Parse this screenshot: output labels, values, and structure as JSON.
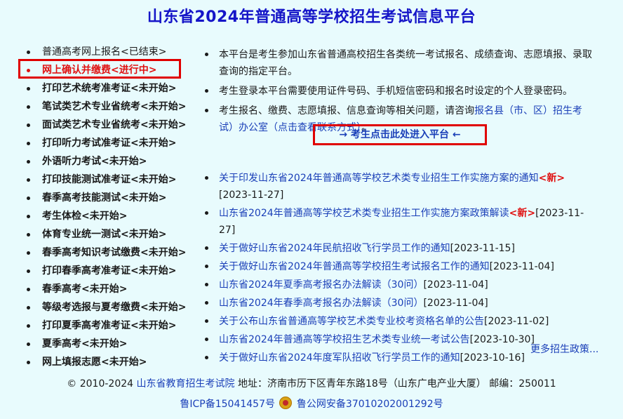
{
  "title": "山东省2024年普通高等学校招生考试信息平台",
  "left_items": [
    {
      "label": "普通高考网上报名<已结束>",
      "state": "normal"
    },
    {
      "label": "网上确认并缴费<进行中>",
      "state": "active"
    },
    {
      "label": "打印艺术统考准考证<未开始>",
      "state": "bold"
    },
    {
      "label": "笔试类艺术专业省统考<未开始>",
      "state": "bold"
    },
    {
      "label": "面试类艺术专业省统考<未开始>",
      "state": "bold"
    },
    {
      "label": "打印听力考试准考证<未开始>",
      "state": "bold"
    },
    {
      "label": "外语听力考试<未开始>",
      "state": "bold"
    },
    {
      "label": "打印技能测试准考证<未开始>",
      "state": "bold"
    },
    {
      "label": "春季高考技能测试<未开始>",
      "state": "bold"
    },
    {
      "label": "考生体检<未开始>",
      "state": "bold"
    },
    {
      "label": "体育专业统一测试<未开始>",
      "state": "bold"
    },
    {
      "label": "春季高考知识考试缴费<未开始>",
      "state": "bold"
    },
    {
      "label": "打印春季高考准考证<未开始>",
      "state": "bold"
    },
    {
      "label": "春季高考<未开始>",
      "state": "bold"
    },
    {
      "label": "等级考选报与夏考缴费<未开始>",
      "state": "bold"
    },
    {
      "label": "打印夏季高考准考证<未开始>",
      "state": "bold"
    },
    {
      "label": "夏季高考<未开始>",
      "state": "bold"
    },
    {
      "label": "网上填报志愿<未开始>",
      "state": "bold"
    }
  ],
  "notes": {
    "n1": "本平台是考生参加山东省普通高校招生各类统一考试报名、成绩查询、志愿填报、录取查询的指定平台。",
    "n2": "考生登录本平台需要使用证件号码、手机短信密码和报名时设定的个人登录密码。",
    "n3_pre": "考生报名、缴费、志愿填报、信息查询等相关问题，请咨询",
    "n3_link": "报名县（市、区）招生考试）办公室（点击查看联系方式）",
    "n3_post": "。"
  },
  "enter_button": "→ 考生点击此处进入平台 ←",
  "news": [
    {
      "title": "关于印发山东省2024年普通高等学校艺术类专业招生工作实施方案的通知",
      "new": "<新>",
      "date": "[2023-11-27]"
    },
    {
      "title": "山东省2024年普通高等学校艺术类专业招生工作实施方案政策解读",
      "new": "<新>",
      "date": "[2023-11-27]"
    },
    {
      "title": "关于做好山东省2024年民航招收飞行学员工作的通知",
      "new": "",
      "date": "[2023-11-15]"
    },
    {
      "title": "关于做好山东省2024年普通高等学校招生考试报名工作的通知",
      "new": "",
      "date": "[2023-11-04]"
    },
    {
      "title": "山东省2024年夏季高考报名办法解读（30问）",
      "new": "",
      "date": "[2023-11-04]"
    },
    {
      "title": "山东省2024年春季高考报名办法解读（30问）",
      "new": "",
      "date": "[2023-11-04]"
    },
    {
      "title": "关于公布山东省普通高等学校艺术类专业校考资格名单的公告",
      "new": "",
      "date": "[2023-11-02]"
    },
    {
      "title": "山东省2024年普通高等学校招生艺术类专业统一考试公告",
      "new": "",
      "date": "[2023-10-30]"
    },
    {
      "title": "关于做好山东省2024年度军队招收飞行学员工作的通知",
      "new": "",
      "date": "[2023-10-16]"
    }
  ],
  "more_link": "更多招生政策...",
  "footer": {
    "copyright": "© 2010-2024",
    "org": "山东省教育招生考试院",
    "address": "地址：济南市历下区青年东路18号（山东广电产业大厦） 邮编：250011",
    "icp": "鲁ICP备15041457号",
    "police": "鲁公网安备37010202001292号"
  },
  "colors": {
    "title": "#1515c8",
    "link": "#1a3fb8",
    "active": "#e01010",
    "highlight_border": "#e00000",
    "background": "#e8fbfd"
  }
}
